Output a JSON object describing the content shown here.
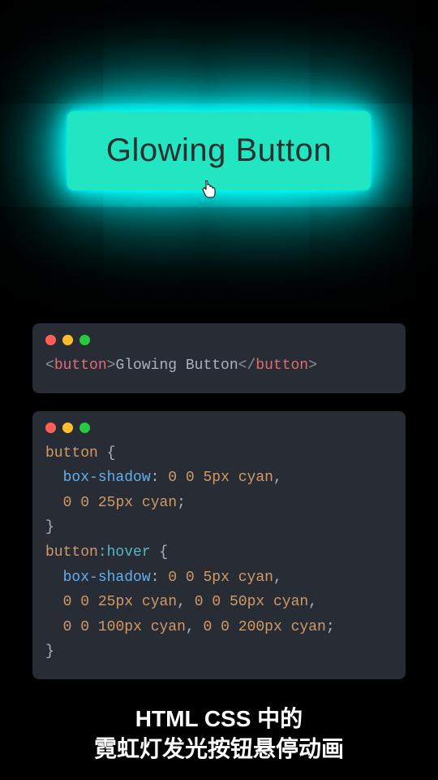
{
  "demo": {
    "buttonLabel": "Glowing Button"
  },
  "htmlCode": {
    "openAngle": "<",
    "tag": "button",
    "gt": ">",
    "text": "Glowing Button",
    "closeOpen": "</",
    "closeGt": ">"
  },
  "css": {
    "sel1": "button",
    "open": " {",
    "prop1": "box-shadow",
    "v_5": "5px",
    "v_25": "25px",
    "v_50": "50px",
    "v_100": "100px",
    "v_200": "200px",
    "zero": "0",
    "cyan": "cyan",
    "close": "}",
    "sel2a": "button",
    "sel2b": ":hover"
  },
  "caption": {
    "line1": "HTML CSS 中的",
    "line2": "霓虹灯发光按钮悬停动画"
  }
}
